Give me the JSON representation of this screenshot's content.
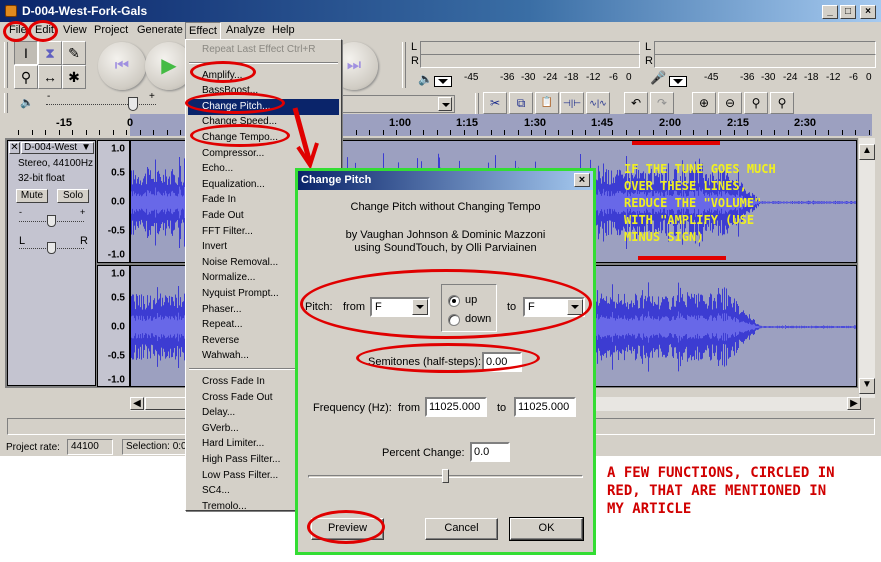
{
  "window": {
    "title": "D-004-West-Fork-Gals",
    "controls": [
      "_",
      "□",
      "×"
    ]
  },
  "menubar": {
    "items": [
      "File",
      "Edit",
      "View",
      "Project",
      "Generate",
      "Effect",
      "Analyze",
      "Help"
    ],
    "active": "Effect"
  },
  "tools": {
    "buttons": [
      {
        "name": "selection-tool",
        "glyph": "I"
      },
      {
        "name": "envelope-tool",
        "glyph": "⧗"
      },
      {
        "name": "draw-tool",
        "glyph": "✎"
      },
      {
        "name": "zoom-tool",
        "glyph": "⚲"
      },
      {
        "name": "timeshift-tool",
        "glyph": "↔"
      },
      {
        "name": "multi-tool",
        "glyph": "✱"
      }
    ],
    "transport": [
      {
        "name": "skip-start",
        "glyph": "⏮",
        "color": "#a090e0"
      },
      {
        "name": "play",
        "glyph": "▶",
        "color": "#44bb44"
      },
      {
        "name": "skip-end",
        "glyph": "⏭",
        "color": "#a090e0"
      }
    ]
  },
  "meters": {
    "playback": {
      "L": "L",
      "R": "R",
      "scale": [
        "-45",
        "-36",
        "-30",
        "-24",
        "-18",
        "-12",
        "-6",
        "0"
      ]
    },
    "record": {
      "L": "L",
      "R": "R",
      "scale": [
        "-45",
        "-36",
        "-30",
        "-24",
        "-18",
        "-12",
        "-6",
        "0"
      ]
    }
  },
  "mixer": {
    "volume_min": "-",
    "volume_max": "+"
  },
  "edit_toolbar": [
    {
      "name": "cut",
      "glyph": "✂"
    },
    {
      "name": "copy",
      "glyph": "⧉"
    },
    {
      "name": "paste",
      "glyph": "📋"
    },
    {
      "name": "trim",
      "glyph": "⊣|⊢"
    },
    {
      "name": "silence",
      "glyph": "∿|∿"
    },
    {
      "name": "undo",
      "glyph": "↶"
    },
    {
      "name": "redo",
      "glyph": "↷"
    },
    {
      "name": "zoom-in",
      "glyph": "⊕"
    },
    {
      "name": "zoom-out",
      "glyph": "⊖"
    },
    {
      "name": "fit-selection",
      "glyph": "⚲"
    },
    {
      "name": "fit-project",
      "glyph": "⚲"
    }
  ],
  "ruler": {
    "labels": [
      "-15",
      "0",
      "1:00",
      "1:15",
      "1:30",
      "1:45",
      "2:00",
      "2:15",
      "2:30"
    ]
  },
  "track": {
    "name": "D-004-West",
    "format": "Stereo, 44100Hz",
    "bits": "32-bit float",
    "mute": "Mute",
    "solo": "Solo",
    "gain_min": "-",
    "gain_max": "+",
    "pan_left": "L",
    "pan_right": "R",
    "scale": [
      "1.0",
      "0.5",
      "0.0",
      "-0.5",
      "-1.0"
    ]
  },
  "statusbar": {
    "rate_label": "Project rate:",
    "rate_value": "44100",
    "selection_label": "Selection: 0:0"
  },
  "effect_menu": {
    "items": [
      {
        "label": "Repeat Last Effect   Ctrl+R",
        "disabled": true
      },
      {
        "sep": true
      },
      {
        "label": "Amplify..."
      },
      {
        "label": "BassBoost..."
      },
      {
        "label": "Change Pitch...",
        "selected": true
      },
      {
        "label": "Change Speed..."
      },
      {
        "label": "Change Tempo..."
      },
      {
        "label": "Compressor..."
      },
      {
        "label": "Echo..."
      },
      {
        "label": "Equalization..."
      },
      {
        "label": "Fade In"
      },
      {
        "label": "Fade Out"
      },
      {
        "label": "FFT Filter..."
      },
      {
        "label": "Invert"
      },
      {
        "label": "Noise Removal..."
      },
      {
        "label": "Normalize..."
      },
      {
        "label": "Nyquist Prompt..."
      },
      {
        "label": "Phaser..."
      },
      {
        "label": "Repeat..."
      },
      {
        "label": "Reverse"
      },
      {
        "label": "Wahwah..."
      },
      {
        "sep": true
      },
      {
        "label": "Cross Fade In"
      },
      {
        "label": "Cross Fade Out"
      },
      {
        "label": "Delay..."
      },
      {
        "label": "GVerb..."
      },
      {
        "label": "Hard Limiter..."
      },
      {
        "label": "High Pass Filter..."
      },
      {
        "label": "Low Pass Filter..."
      },
      {
        "label": "SC4..."
      },
      {
        "label": "Tremolo..."
      }
    ]
  },
  "dialog": {
    "title": "Change Pitch",
    "close": "×",
    "heading": "Change Pitch without Changing Tempo",
    "credits_1": "by Vaughan Johnson & Dominic Mazzoni",
    "credits_2": "using SoundTouch, by Olli Parviainen",
    "pitch_label": "Pitch:",
    "from_label": "from",
    "from_value": "F",
    "to_label": "to",
    "to_value": "F",
    "direction_up": "up",
    "direction_down": "down",
    "direction_selected": "up",
    "semitones_label": "Semitones (half-steps):",
    "semitones_value": "0.00",
    "freq_label": "Frequency (Hz):",
    "freq_from_label": "from",
    "freq_from_value": "11025.000",
    "freq_to_label": "to",
    "freq_to_value": "11025.000",
    "percent_label": "Percent Change:",
    "percent_value": "0.0",
    "slider_fraction": 0.5,
    "preview": "Preview",
    "cancel": "Cancel",
    "ok": "OK"
  },
  "annotations": {
    "waveform_note": "IF THE TUNE GOES MUCH\nOVER THESE LINES,\nREDUCE THE \"VOLUME\"\nWITH \"AMPLIFY (USE\nMINUS SIGN)",
    "waveform_note_color": "#f0f020",
    "footer_note": "A FEW FUNCTIONS, CIRCLED IN\nRED, THAT ARE MENTIONED IN\nMY ARTICLE",
    "footer_note_color": "#d00000",
    "circle_color": "#e00000",
    "dialog_border_color": "#33dd33"
  }
}
